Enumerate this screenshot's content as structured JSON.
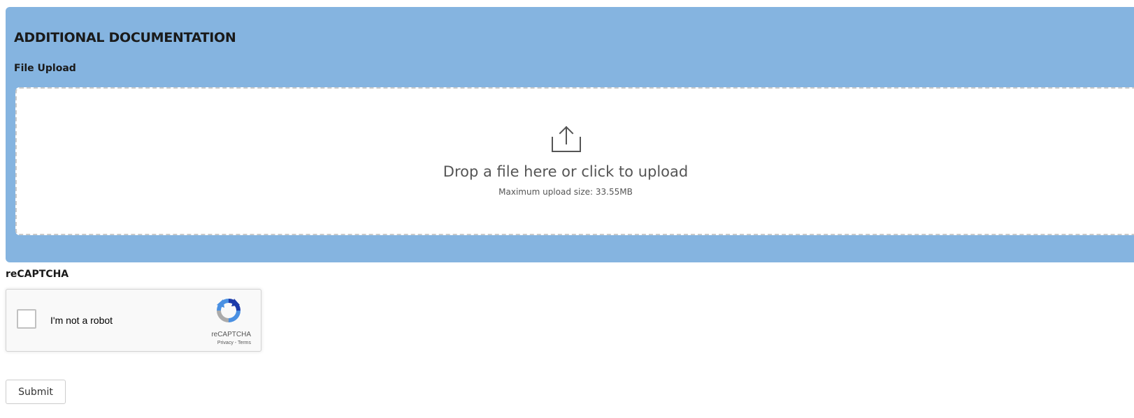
{
  "section": {
    "title": "ADDITIONAL DOCUMENTATION",
    "field_label": "File Upload"
  },
  "dropzone": {
    "icon": "upload-icon",
    "main_text": "Drop a file here or click to upload",
    "sub_text": "Maximum upload size: 33.55MB"
  },
  "recaptcha": {
    "heading": "reCAPTCHA",
    "checkbox_label": "I'm not a robot",
    "brand": "reCAPTCHA",
    "privacy_link": "Privacy",
    "separator": " - ",
    "terms_link": "Terms"
  },
  "form": {
    "submit_label": "Submit"
  },
  "colors": {
    "panel_bg": "#85b4e0",
    "dropzone_bg": "#ffffff",
    "dropzone_border": "#c9c9c9",
    "recaptcha_blue_dark": "#1c3aa9",
    "recaptcha_blue_light": "#4a90e2",
    "recaptcha_gray": "#ababab"
  }
}
